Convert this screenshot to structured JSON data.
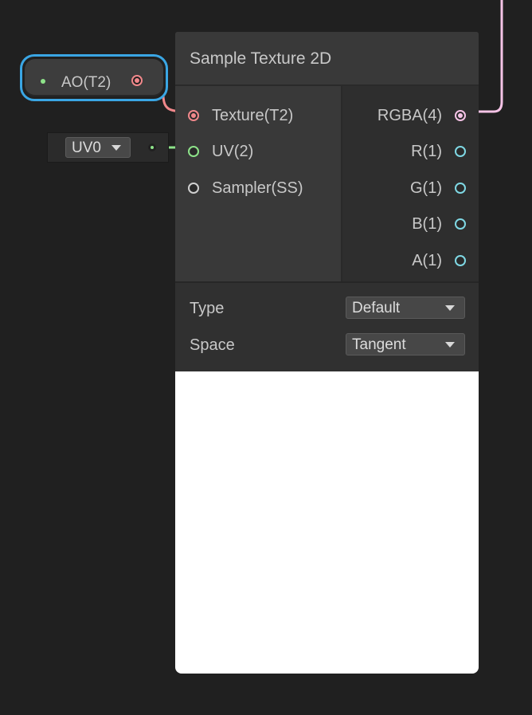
{
  "property_node": {
    "label": "AO(T2)"
  },
  "uv_node": {
    "dropdown_value": "UV0"
  },
  "node": {
    "title": "Sample Texture 2D",
    "inputs": [
      {
        "label": "Texture(T2)"
      },
      {
        "label": "UV(2)"
      },
      {
        "label": "Sampler(SS)"
      }
    ],
    "outputs": [
      {
        "label": "RGBA(4)"
      },
      {
        "label": "R(1)"
      },
      {
        "label": "G(1)"
      },
      {
        "label": "B(1)"
      },
      {
        "label": "A(1)"
      }
    ],
    "settings": {
      "type_label": "Type",
      "type_value": "Default",
      "space_label": "Space",
      "space_value": "Tangent"
    }
  },
  "colors": {
    "selection": "#3aa6e4",
    "texture_port": "#f1888b",
    "vector2_port": "#8ee38a",
    "vector4_port": "#f5c3e6",
    "float_port": "#7fd8e4",
    "sampler_port": "#b8b8b8"
  }
}
